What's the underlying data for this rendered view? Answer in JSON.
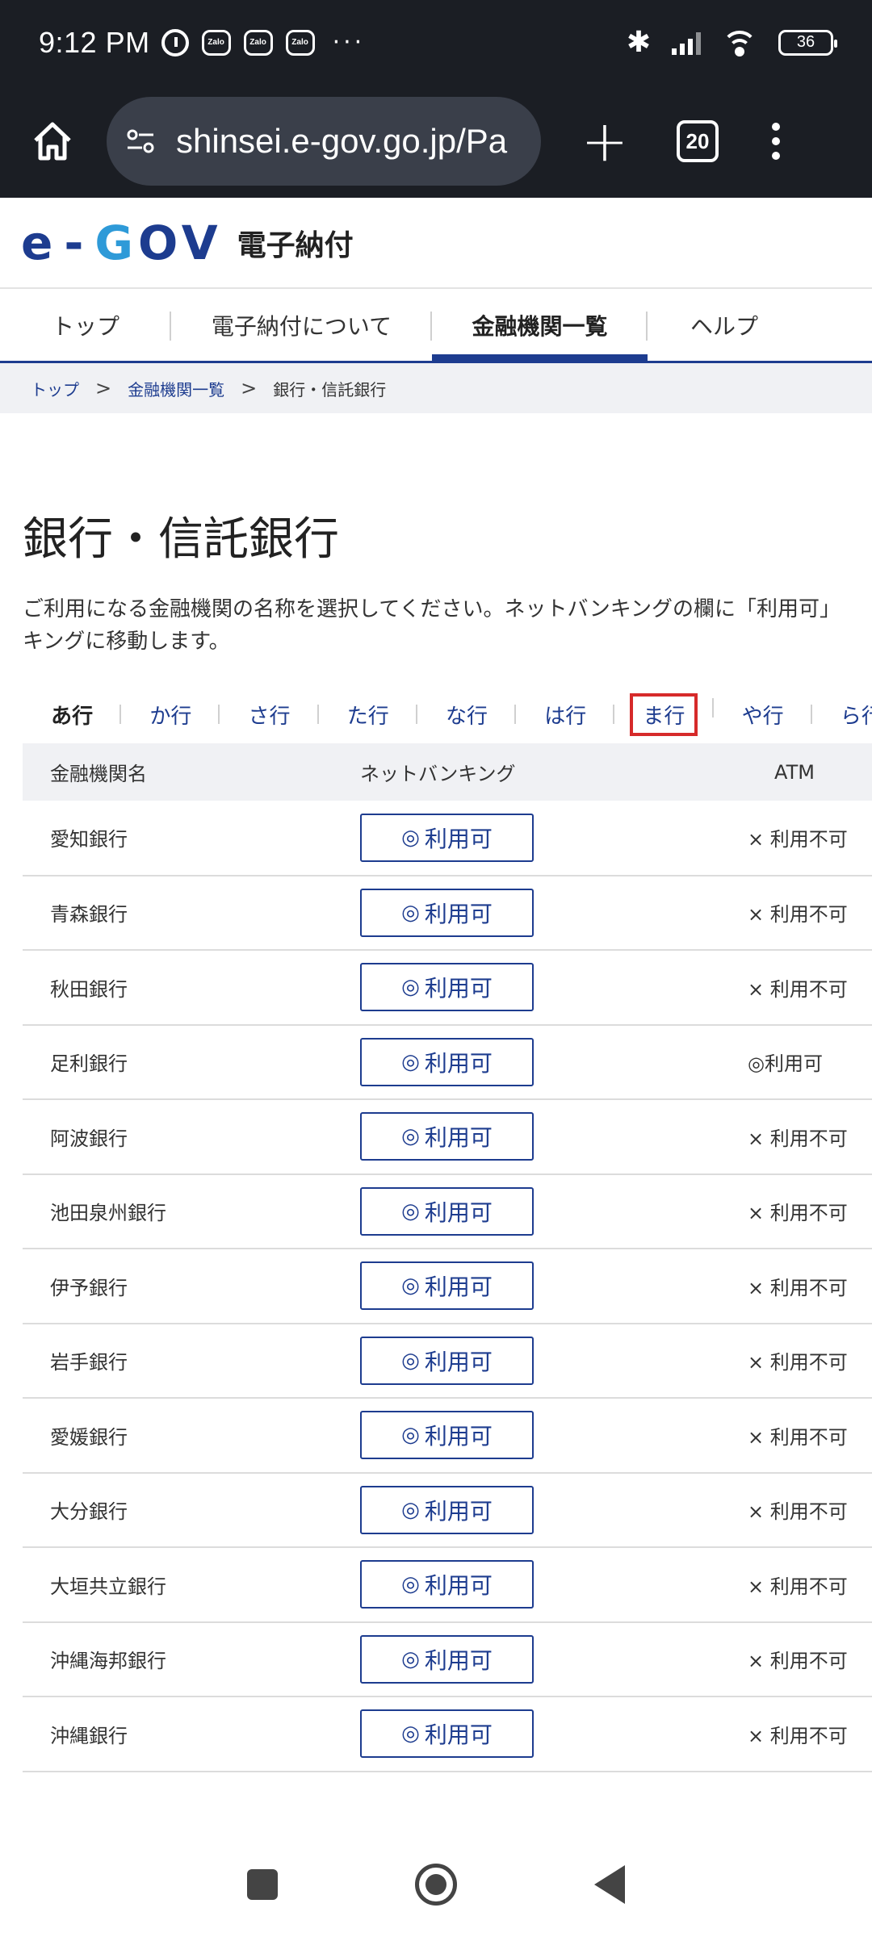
{
  "status_bar": {
    "time": "9:12 PM",
    "notification_app": "Zalo",
    "overflow": "···",
    "battery_level": "36"
  },
  "browser": {
    "url": "shinsei.e-gov.go.jp/Pa",
    "tab_count": "20"
  },
  "site": {
    "logo_e": "e",
    "logo_dash": "-",
    "logo_g": "G",
    "logo_ov": "OV",
    "title": "電子納付"
  },
  "global_nav": {
    "items": [
      {
        "label": "トップ"
      },
      {
        "label": "電子納付について"
      },
      {
        "label": "金融機関一覧"
      },
      {
        "label": "ヘルプ"
      }
    ],
    "active_index": 2
  },
  "breadcrumb": {
    "items": [
      "トップ",
      "金融機関一覧",
      "銀行・信託銀行"
    ],
    "separator": ">"
  },
  "page": {
    "title": "銀行・信託銀行",
    "description_line1": "ご利用になる金融機関の名称を選択してください。ネットバンキングの欄に「利用可」",
    "description_line2": "キングに移動します。"
  },
  "kana_tabs": {
    "items": [
      "あ行",
      "か行",
      "さ行",
      "た行",
      "な行",
      "は行",
      "ま行",
      "や行",
      "ら行"
    ],
    "current": "あ行",
    "highlighted": "ま行"
  },
  "table": {
    "headers": {
      "name": "金融機関名",
      "net_banking": "ネットバンキング",
      "atm": "ATM"
    },
    "net_banking_label": "利用可",
    "available_mark": "◎",
    "rows": [
      {
        "name": "愛知銀行",
        "atm": "× 利用不可"
      },
      {
        "name": "青森銀行",
        "atm": "× 利用不可"
      },
      {
        "name": "秋田銀行",
        "atm": "× 利用不可"
      },
      {
        "name": "足利銀行",
        "atm": "◎利用可"
      },
      {
        "name": "阿波銀行",
        "atm": "× 利用不可"
      },
      {
        "name": "池田泉州銀行",
        "atm": "× 利用不可"
      },
      {
        "name": "伊予銀行",
        "atm": "× 利用不可"
      },
      {
        "name": "岩手銀行",
        "atm": "× 利用不可"
      },
      {
        "name": "愛媛銀行",
        "atm": "× 利用不可"
      },
      {
        "name": "大分銀行",
        "atm": "× 利用不可"
      },
      {
        "name": "大垣共立銀行",
        "atm": "× 利用不可"
      },
      {
        "name": "沖縄海邦銀行",
        "atm": "× 利用不可"
      },
      {
        "name": "沖縄銀行",
        "atm": "× 利用不可"
      }
    ]
  },
  "colors": {
    "brand_navy": "#1d3c8f",
    "brand_light_blue": "#2e9ad8",
    "highlight_red": "#d62a2a",
    "system_bar": "#1b1e24"
  }
}
